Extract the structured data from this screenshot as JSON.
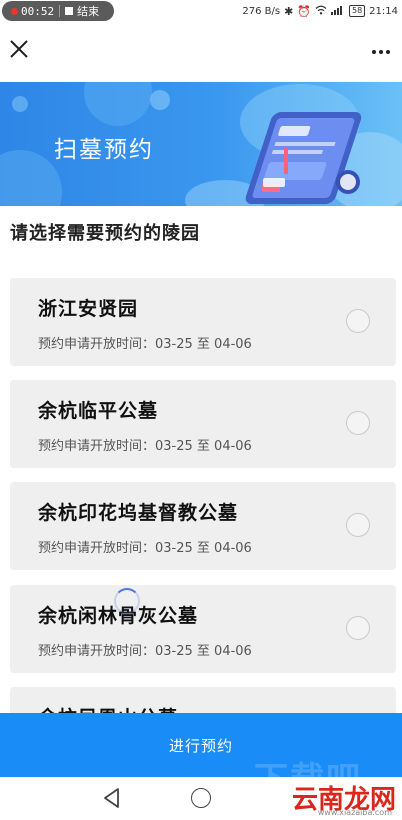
{
  "status_bar": {
    "rec_time": "00:52",
    "rec_end_label": "结束",
    "net_speed": "276 B/s",
    "battery": "58",
    "clock": "21:14"
  },
  "banner": {
    "title": "扫墓预约"
  },
  "page": {
    "heading": "请选择需要预约的陵园"
  },
  "cemeteries": [
    {
      "name": "浙江安贤园",
      "period_label": "预约申请开放时间：",
      "period": "03-25 至 04-06"
    },
    {
      "name": "余杭临平公墓",
      "period_label": "预约申请开放时间：",
      "period": "03-25 至 04-06"
    },
    {
      "name": "余杭印花坞基督教公墓",
      "period_label": "预约申请开放时间：",
      "period": "03-25 至 04-06"
    },
    {
      "name": "余杭闲林骨灰公墓",
      "period_label": "预约申请开放时间：",
      "period": "03-25 至 04-06"
    },
    {
      "name": "余杭凤凰山公墓"
    }
  ],
  "submit_label": "进行预约",
  "watermark": {
    "brand": "云南龙网",
    "domain": "www.xiazaiba.com",
    "bg_text": "下载吧"
  },
  "colors": {
    "accent": "#1a8cf7",
    "card_bg": "#efefef",
    "watermark": "#d8281e"
  },
  "icons": {
    "close": "close-icon",
    "more": "more-icon",
    "back": "back-triangle-icon",
    "home": "home-circle-icon"
  }
}
